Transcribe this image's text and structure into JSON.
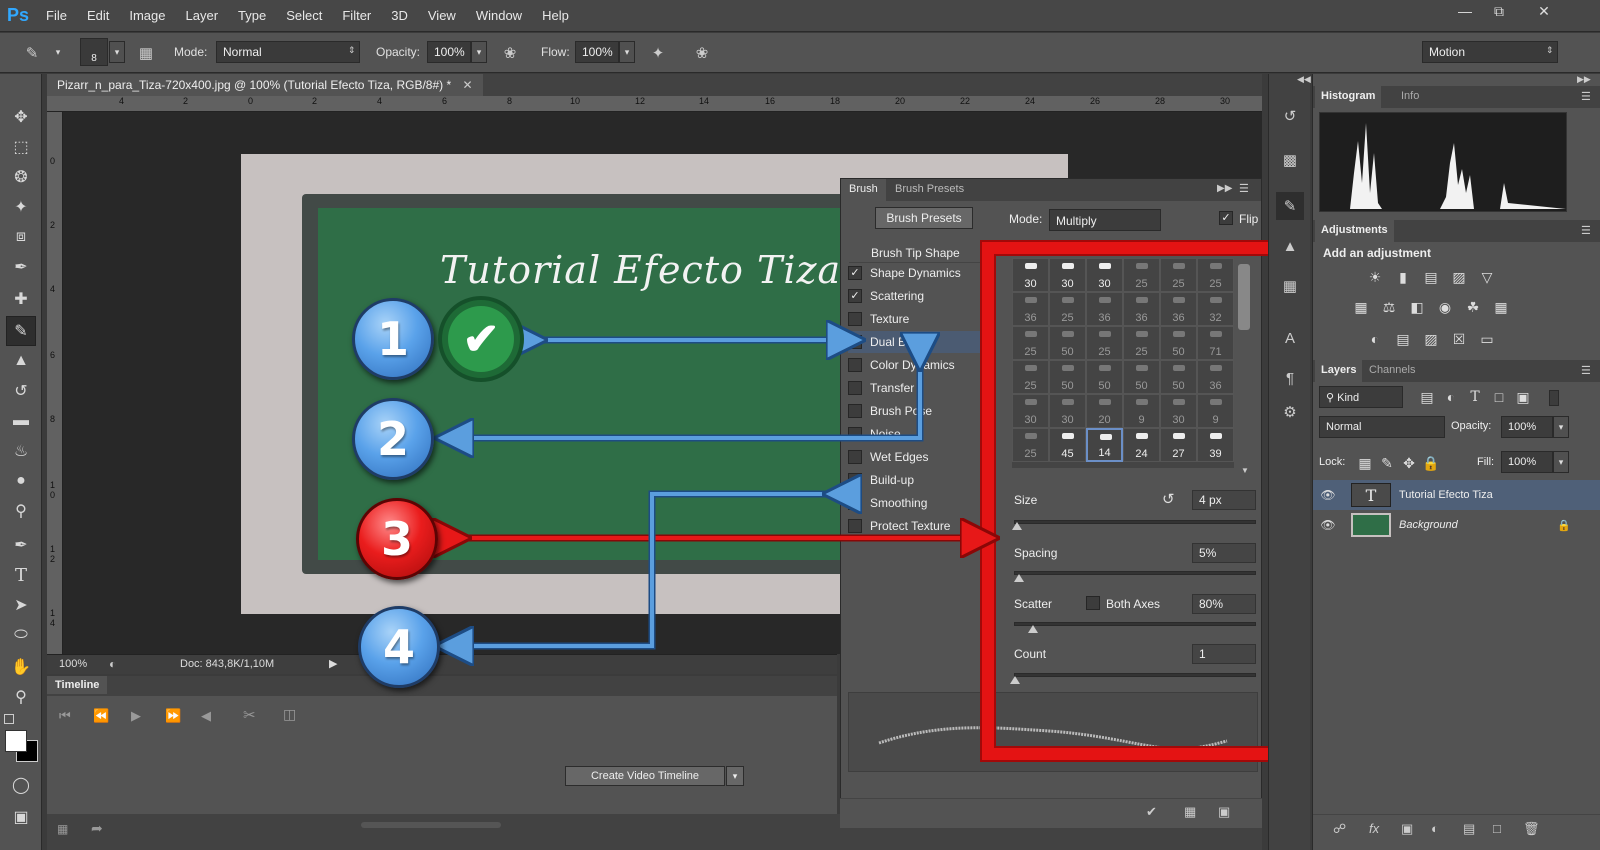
{
  "menubar": {
    "logo": "Ps",
    "items": [
      "File",
      "Edit",
      "Image",
      "Layer",
      "Type",
      "Select",
      "Filter",
      "3D",
      "View",
      "Window",
      "Help"
    ]
  },
  "options": {
    "brush_size": "8",
    "mode_label": "Mode:",
    "mode_value": "Normal",
    "opacity_label": "Opacity:",
    "opacity_value": "100%",
    "flow_label": "Flow:",
    "flow_value": "100%",
    "workspace": "Motion"
  },
  "document": {
    "tab_title": "Pizarr_n_para_Tiza-720x400.jpg @ 100% (Tutorial Efecto Tiza, RGB/8#) *",
    "board_text": "Tutorial Efecto Tiza",
    "zoom": "100%",
    "doc_size": "Doc: 843,8K/1,10M",
    "ruler_h": [
      "4",
      "2",
      "0",
      "2",
      "4",
      "6",
      "8",
      "10",
      "12",
      "14",
      "16",
      "18",
      "20",
      "22",
      "24",
      "26",
      "28",
      "30"
    ],
    "ruler_v": [
      "0",
      "2",
      "4",
      "6",
      "8",
      "1 0",
      "1 2",
      "1 4"
    ]
  },
  "timeline": {
    "tab": "Timeline",
    "create_button": "Create Video Timeline"
  },
  "brush_panel": {
    "tabs": [
      "Brush",
      "Brush Presets"
    ],
    "presets_button": "Brush Presets",
    "mode_label": "Mode:",
    "mode_value": "Multiply",
    "flip_label": "Flip",
    "tip_shape_header": "Brush Tip Shape",
    "options": [
      {
        "label": "Shape Dynamics",
        "checked": true
      },
      {
        "label": "Scattering",
        "checked": true
      },
      {
        "label": "Texture",
        "checked": false
      },
      {
        "label": "Dual Brush",
        "checked": true
      },
      {
        "label": "Color Dynamics",
        "checked": false
      },
      {
        "label": "Transfer",
        "checked": false
      },
      {
        "label": "Brush Pose",
        "checked": false
      },
      {
        "label": "Noise",
        "checked": false
      },
      {
        "label": "Wet Edges",
        "checked": false
      },
      {
        "label": "Build-up",
        "checked": false
      },
      {
        "label": "Smoothing",
        "checked": true
      },
      {
        "label": "Protect Texture",
        "checked": false
      }
    ],
    "tips": [
      [
        "30",
        "30",
        "30",
        "25",
        "25",
        "25"
      ],
      [
        "36",
        "25",
        "36",
        "36",
        "36",
        "32"
      ],
      [
        "25",
        "50",
        "25",
        "25",
        "50",
        "71"
      ],
      [
        "25",
        "50",
        "50",
        "50",
        "50",
        "36"
      ],
      [
        "30",
        "30",
        "20",
        "9",
        "30",
        "9"
      ],
      [
        "25",
        "45",
        "14",
        "24",
        "27",
        "39"
      ]
    ],
    "size_label": "Size",
    "size_value": "4 px",
    "spacing_label": "Spacing",
    "spacing_value": "5%",
    "scatter_label": "Scatter",
    "both_axes_label": "Both Axes",
    "scatter_value": "80%",
    "count_label": "Count",
    "count_value": "1"
  },
  "right_panels": {
    "histogram_tabs": [
      "Histogram",
      "Info"
    ],
    "adjustments_tab": "Adjustments",
    "adjustments_subtitle": "Add an adjustment",
    "layers_tabs": [
      "Layers",
      "Channels"
    ],
    "kind_label": "Kind",
    "blend_mode": "Normal",
    "opacity_label": "Opacity:",
    "opacity_value": "100%",
    "lock_label": "Lock:",
    "fill_label": "Fill:",
    "fill_value": "100%",
    "layers": [
      {
        "name": "Tutorial Efecto Tiza",
        "type": "text"
      },
      {
        "name": "Background",
        "type": "image"
      }
    ]
  },
  "callouts": [
    "1",
    "2",
    "3",
    "4"
  ],
  "colors": {
    "callout_blue": "#5aa2ea",
    "callout_red": "#ea1d1d",
    "highlight_frame": "#e41313",
    "board_green": "#2f6e47"
  }
}
